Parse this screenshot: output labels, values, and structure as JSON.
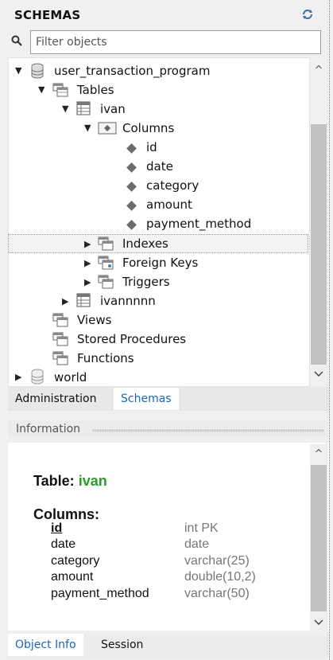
{
  "header": {
    "title": "SCHEMAS",
    "refresh_icon": "refresh-icon"
  },
  "filter": {
    "placeholder": "Filter objects",
    "value": ""
  },
  "tree": {
    "schema1": "user_transaction_program",
    "tables": "Tables",
    "table_ivan": "ivan",
    "columns": "Columns",
    "cols": [
      "id",
      "date",
      "category",
      "amount",
      "payment_method"
    ],
    "indexes": "Indexes",
    "foreign_keys": "Foreign Keys",
    "triggers": "Triggers",
    "table_ivannnnn": "ivannnnn",
    "views": "Views",
    "stored_procedures": "Stored Procedures",
    "functions": "Functions",
    "schema2": "world"
  },
  "tabs": {
    "administration": "Administration",
    "schemas": "Schemas"
  },
  "information": {
    "title": "Information",
    "table_label": "Table:",
    "table_name": "ivan",
    "columns_label": "Columns:",
    "columns": [
      {
        "name": "id",
        "type": "int PK"
      },
      {
        "name": "date",
        "type": "date"
      },
      {
        "name": "category",
        "type": "varchar(25)"
      },
      {
        "name": "amount",
        "type": "double(10,2)"
      },
      {
        "name": "payment_method",
        "type": "varchar(50)"
      }
    ]
  },
  "bottom_tabs": {
    "object_info": "Object Info",
    "session": "Session"
  },
  "colors": {
    "accent": "#1a66b8",
    "table_name": "#2e9a2e"
  }
}
